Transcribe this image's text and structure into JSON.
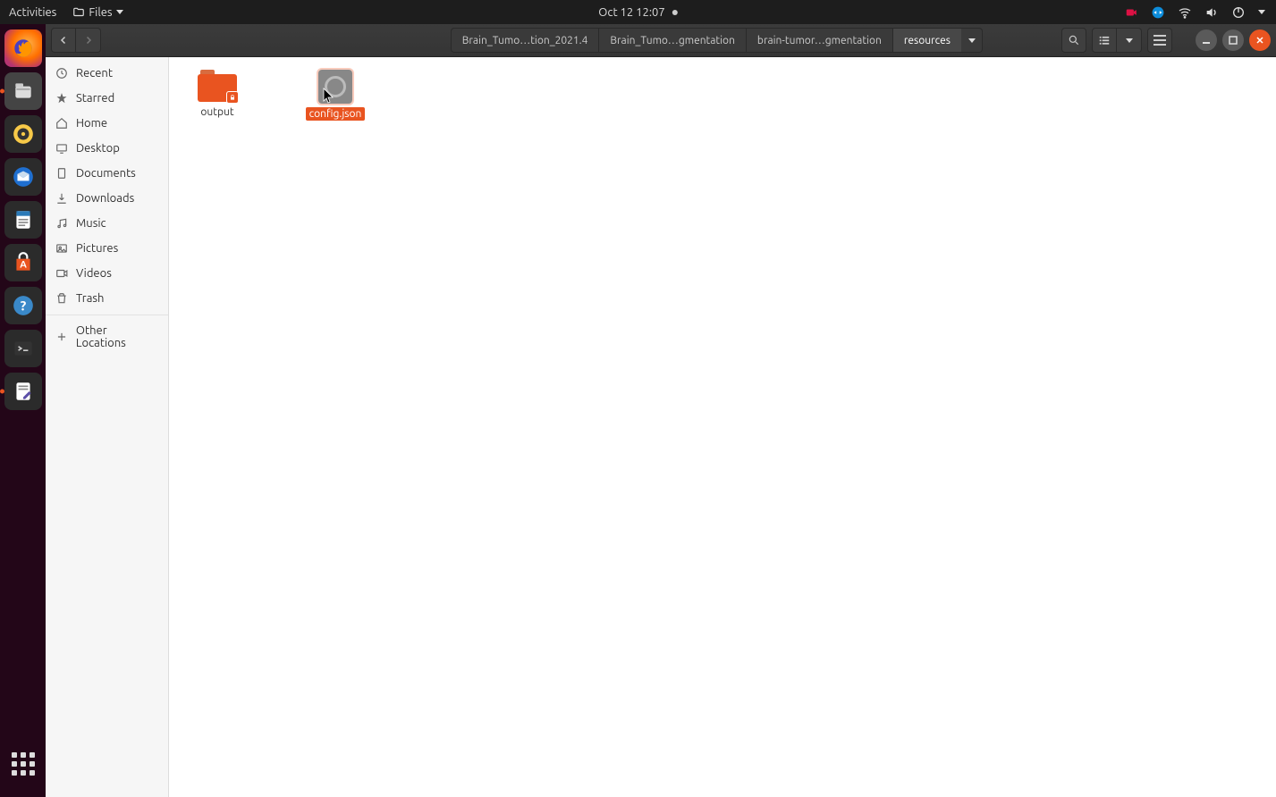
{
  "top_panel": {
    "activities": "Activities",
    "app_menu": "Files",
    "datetime": "Oct 12  12:07"
  },
  "dock": {
    "items": [
      "firefox",
      "files",
      "rhythmbox",
      "thunderbird",
      "writer",
      "software",
      "help",
      "terminal",
      "text-editor"
    ]
  },
  "titlebar": {
    "path": [
      "Brain_Tumo…tion_2021.4",
      "Brain_Tumo…gmentation",
      "brain-tumor…gmentation",
      "resources"
    ]
  },
  "sidebar": {
    "items": [
      {
        "icon": "clock",
        "label": "Recent"
      },
      {
        "icon": "star",
        "label": "Starred"
      },
      {
        "icon": "home",
        "label": "Home"
      },
      {
        "icon": "desktop",
        "label": "Desktop"
      },
      {
        "icon": "documents",
        "label": "Documents"
      },
      {
        "icon": "downloads",
        "label": "Downloads"
      },
      {
        "icon": "music",
        "label": "Music"
      },
      {
        "icon": "pictures",
        "label": "Pictures"
      },
      {
        "icon": "videos",
        "label": "Videos"
      },
      {
        "icon": "trash",
        "label": "Trash"
      }
    ],
    "other": {
      "label": "Other Locations"
    }
  },
  "files": {
    "folder": {
      "name": "output"
    },
    "json": {
      "name": "config.json"
    }
  }
}
